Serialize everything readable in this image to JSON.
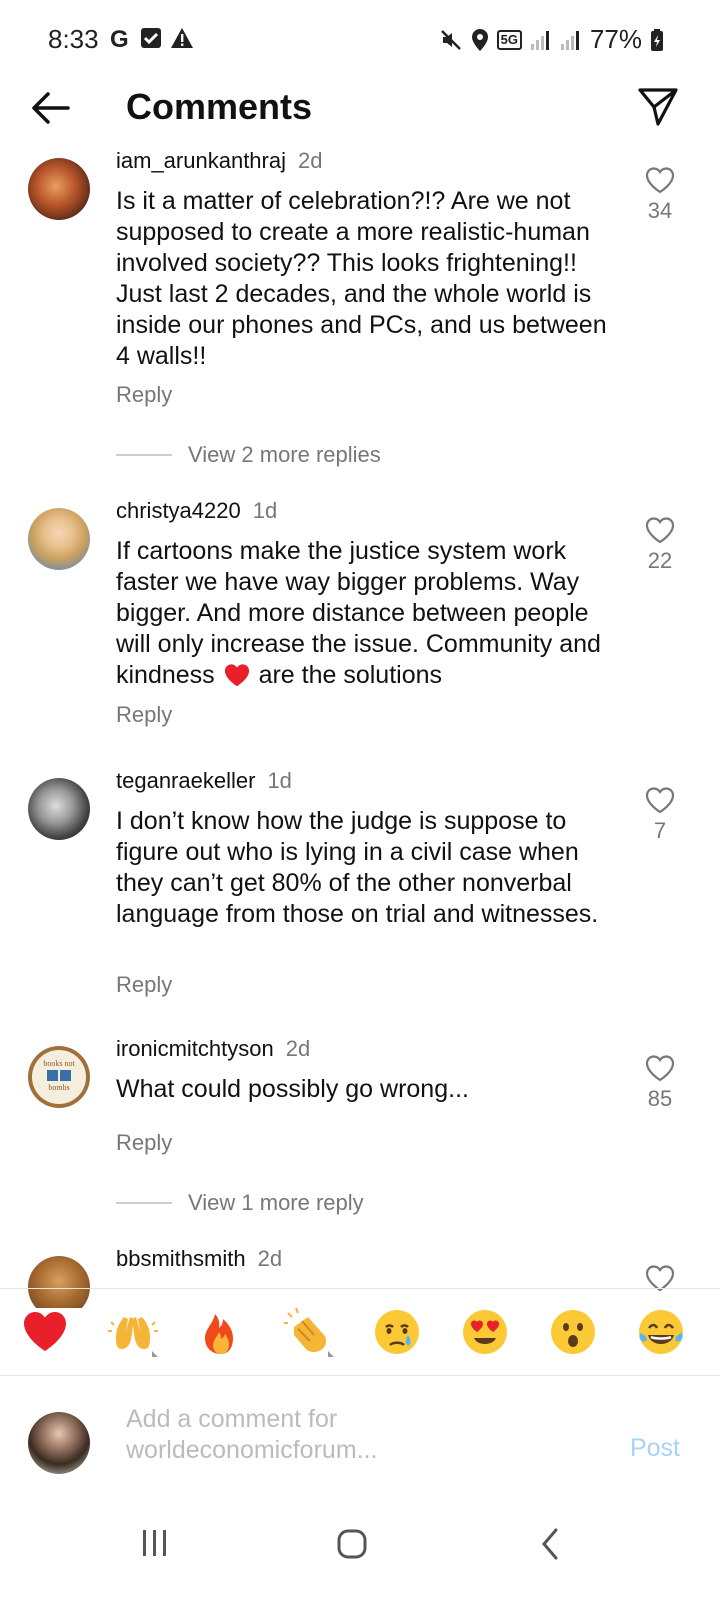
{
  "status_bar": {
    "time": "8:33",
    "battery": "77%",
    "network": "5G"
  },
  "header": {
    "title": "Comments"
  },
  "comments": [
    {
      "username": "iam_arunkanthraj",
      "age": "2d",
      "text": "Is it a matter of celebration?!? Are we not supposed to create a more realistic-human involved society?? This looks frightening!! Just last 2 decades, and the whole world is inside our phones and PCs, and us between 4 walls!!",
      "likes": "34",
      "reply_label": "Reply",
      "more_replies": "View 2 more replies"
    },
    {
      "username": "christya4220",
      "age": "1d",
      "text_before_emoji": "If cartoons make the justice system work faster we have way bigger problems. Way bigger. And more distance between people will only increase the issue. Community and kindness ",
      "text_after_emoji": " are the solutions",
      "likes": "22",
      "reply_label": "Reply"
    },
    {
      "username": "teganraekeller",
      "age": "1d",
      "text": "I don’t know how the judge is suppose to figure out who is lying in a civil case when they can’t get 80% of the other nonverbal language from those on trial and witnesses.",
      "likes": "7",
      "reply_label": "Reply"
    },
    {
      "username": "ironicmitchtyson",
      "age": "2d",
      "text": "What could possibly go wrong...",
      "likes": "85",
      "reply_label": "Reply",
      "more_replies": "View 1 more reply",
      "avatar_text_top": "books not",
      "avatar_text_bottom": "bombs"
    },
    {
      "username": "bbsmithsmith",
      "age": "2d"
    }
  ],
  "reactions": [
    "red-heart",
    "raising-hands",
    "fire",
    "clapping-hands",
    "crying-face",
    "heart-eyes-face",
    "surprised-face",
    "tears-of-joy-face"
  ],
  "composer": {
    "placeholder": "Add a comment for worldeconomicforum...",
    "post_label": "Post"
  },
  "colors": {
    "post_disabled": "#a6d4f7",
    "secondary_text": "#777777",
    "heart_red": "#e8202a"
  }
}
